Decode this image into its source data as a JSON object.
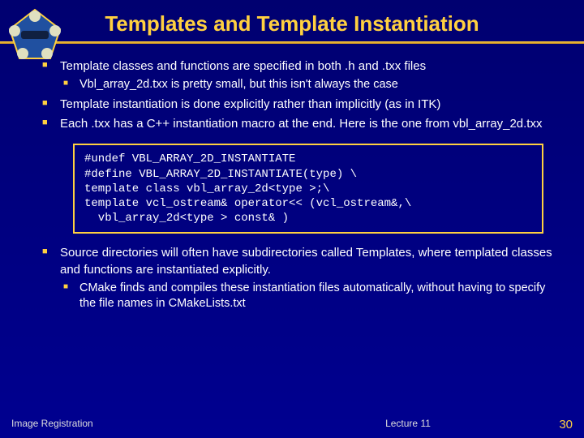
{
  "title": "Templates and Template Instantiation",
  "bullets1": [
    {
      "text": "Template classes and functions are specified in both .h and .txx files",
      "sub": [
        "Vbl_array_2d.txx is pretty small, but this isn't always the case"
      ]
    },
    {
      "text": "Template instantiation is done explicitly rather than implicitly (as in ITK)",
      "sub": []
    },
    {
      "text": "Each .txx has a C++ instantiation macro at the end.  Here is the one from vbl_array_2d.txx",
      "sub": []
    }
  ],
  "code": "#undef VBL_ARRAY_2D_INSTANTIATE\n#define VBL_ARRAY_2D_INSTANTIATE(type) \\\ntemplate class vbl_array_2d<type >;\\\ntemplate vcl_ostream& operator<< (vcl_ostream&,\\\n  vbl_array_2d<type > const& )",
  "bullets2": [
    {
      "text": "Source directories will often have subdirectories called Templates, where templated classes and functions are instantiated explicitly.",
      "sub": [
        "CMake finds and compiles these instantiation files automatically, without having to specify the file names in CMakeLists.txt"
      ]
    }
  ],
  "footer": {
    "left": "Image Registration",
    "mid": "Lecture 11",
    "right": "30"
  }
}
